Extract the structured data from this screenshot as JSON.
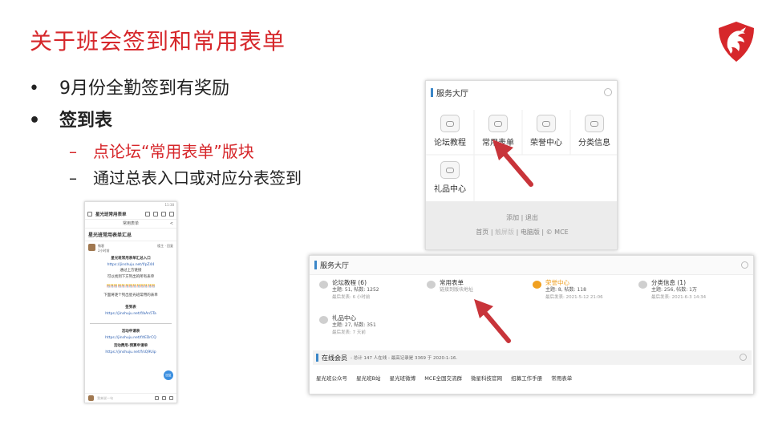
{
  "slide": {
    "title": "关于班会签到和常用表单",
    "bullets": [
      {
        "marker": "•",
        "text": "9月份全勤签到有奖励"
      },
      {
        "marker": "•",
        "text": "签到表"
      }
    ],
    "sub_bullets": [
      {
        "marker": "–",
        "text": "点论坛“常用表单”版块"
      },
      {
        "marker": "–",
        "text": "通过总表入口或对应分表签到"
      }
    ],
    "colors": {
      "accent": "#d6272b",
      "link": "#2a5db0",
      "section_bar": "#3a86c8",
      "arrow": "#c8343a",
      "highlight": "#f0a020"
    }
  },
  "logo": {
    "icon": "dragon-shield-icon"
  },
  "phone": {
    "status_time": "11:38",
    "topbar_title": "星光班常用表单",
    "subbar_title": "常用表单",
    "heading": "星光班常用表单汇总",
    "user_name": "微客",
    "user_time": "2小时前",
    "user_right": "楼主 · 回复",
    "lines": [
      {
        "text": "星光班常用表单汇总入口",
        "style": "bold"
      },
      {
        "text": "https://jinshuju.net/f/pZ44",
        "style": "link"
      },
      {
        "text": "通过上方链接",
        "style": "plain"
      },
      {
        "text": "可以找到下方列出的所有表单",
        "style": "plain"
      }
    ],
    "separator": "🎊🎊🎊🎊🎊🎊🎊🎊🎊🎊🎊🎊🎊",
    "note": "下面将逐个列出星光班常用的表单",
    "forms": [
      {
        "name": "签到表",
        "url": "https://jinshuju.net/f/bAn5Ta"
      },
      {
        "name": "活动申请表",
        "url": "https://jinshuju.net/f/tEDrCQ"
      },
      {
        "name": "活动费用-预算申请单",
        "url": "https://jinshuju.net/f/sQ9Uip"
      }
    ],
    "fab_label": "回复",
    "bottom_placeholder": "我来说一句"
  },
  "panel_top": {
    "title": "服务大厅",
    "tiles": [
      "论坛教程",
      "常用表单",
      "荣誉中心",
      "分类信息",
      "礼品中心"
    ],
    "footer_line1": "添加 | 退出",
    "footer_links": [
      "首页",
      "触屏版",
      "电脑版",
      "© MCE"
    ]
  },
  "panel_bottom": {
    "title": "服务大厅",
    "forums": [
      {
        "name": "论坛教程 (6)",
        "meta": "主题: 51, 帖数: 1252",
        "last": "最后发表: 6 小时前",
        "highlight": false
      },
      {
        "name": "常用表单",
        "meta": "链接到版块地址",
        "last": "",
        "highlight": false
      },
      {
        "name": "荣誉中心",
        "meta": "主题: 8, 帖数: 118",
        "last": "最后发表: 2021-5-12 21:06",
        "highlight": true
      },
      {
        "name": "分类信息 (1)",
        "meta": "主题: 256, 帖数: 1万",
        "last": "最后发表: 2021-6-3 14:34",
        "highlight": false
      },
      {
        "name": "礼品中心",
        "meta": "主题: 27, 帖数: 351",
        "last": "最后发表: 7 天前",
        "highlight": false
      }
    ],
    "online_title": "在线会员",
    "online_stats": "- 总计 147 人在线 - 最高记录是 3369 于 2020-1-16.",
    "links": [
      "星光班公众号",
      "星光班B站",
      "星光班微博",
      "MCE全国交流群",
      "微星科技官网",
      "招募工作手册",
      "常用表单"
    ]
  }
}
